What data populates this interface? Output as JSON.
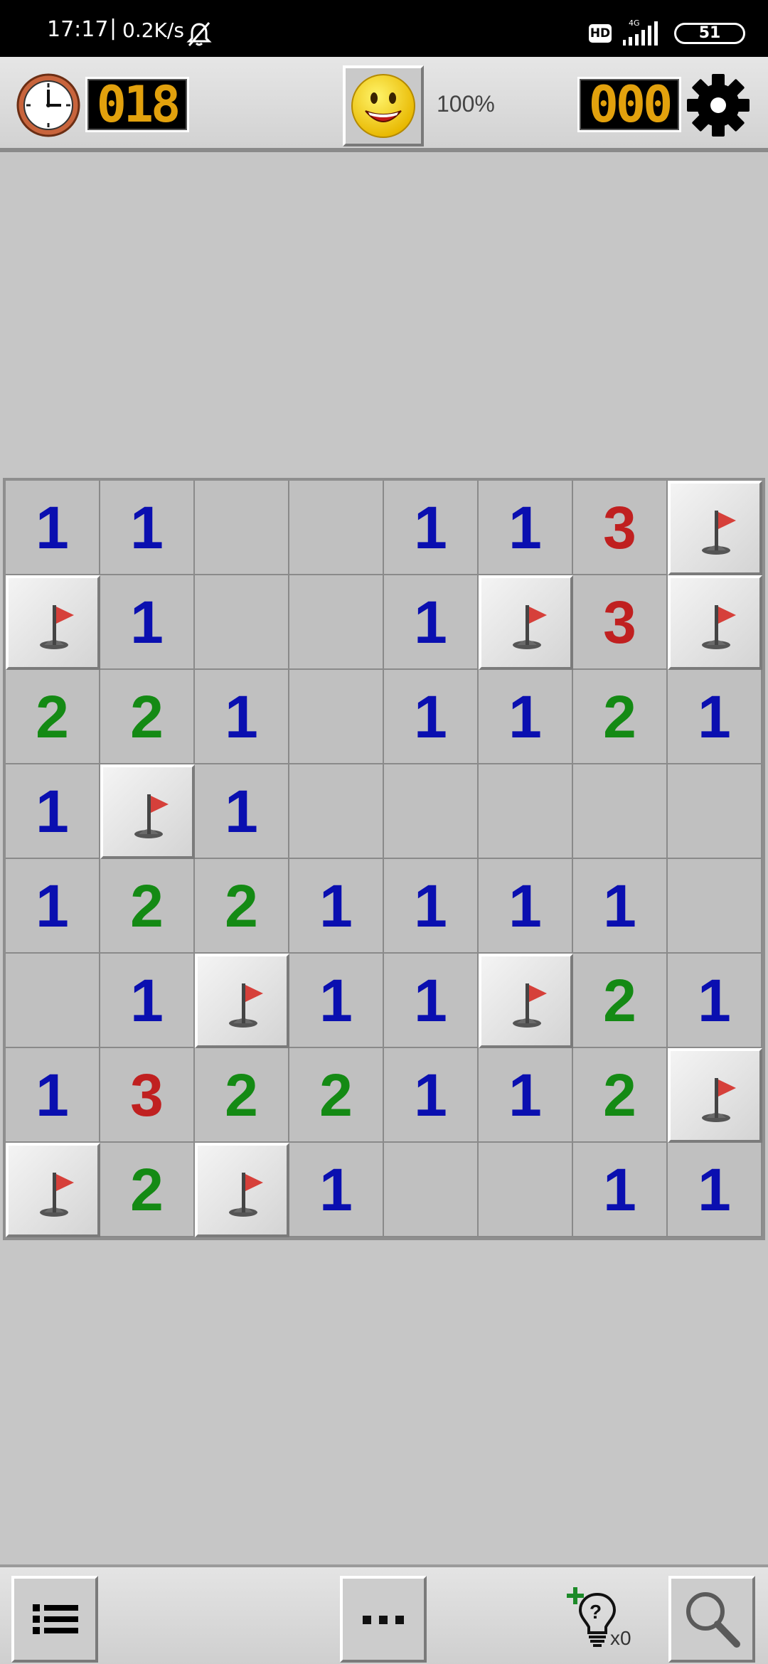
{
  "status_bar": {
    "time": "17:17",
    "separator": "|",
    "net_speed": "0.2K/s",
    "hd_badge": "HD",
    "network_type": "4G",
    "battery": "51"
  },
  "top_bar": {
    "timer_value": "018",
    "zoom_level": "100%",
    "mine_counter": "000",
    "face_state": "smiling"
  },
  "board": {
    "rows": 8,
    "cols": 8,
    "cells": [
      [
        "1",
        "1",
        "",
        "",
        "1",
        "1",
        "3",
        "F"
      ],
      [
        "F",
        "1",
        "",
        "",
        "1",
        "F",
        "3",
        "F"
      ],
      [
        "2",
        "2",
        "1",
        "",
        "1",
        "1",
        "2",
        "1"
      ],
      [
        "1",
        "F",
        "1",
        "",
        "",
        "",
        "",
        ""
      ],
      [
        "1",
        "2",
        "2",
        "1",
        "1",
        "1",
        "1",
        ""
      ],
      [
        "",
        "1",
        "F",
        "1",
        "1",
        "F",
        "2",
        "1"
      ],
      [
        "1",
        "3",
        "2",
        "2",
        "1",
        "1",
        "2",
        "F"
      ],
      [
        "F",
        "2",
        "F",
        "1",
        "",
        "",
        "1",
        "1"
      ]
    ]
  },
  "bottom_bar": {
    "hint_count": "x0"
  },
  "colors": {
    "number_1": "#0a0fb0",
    "number_2": "#148a14",
    "number_3": "#c02020",
    "led_digits": "#e2a10d",
    "flag": "#d6403a"
  }
}
